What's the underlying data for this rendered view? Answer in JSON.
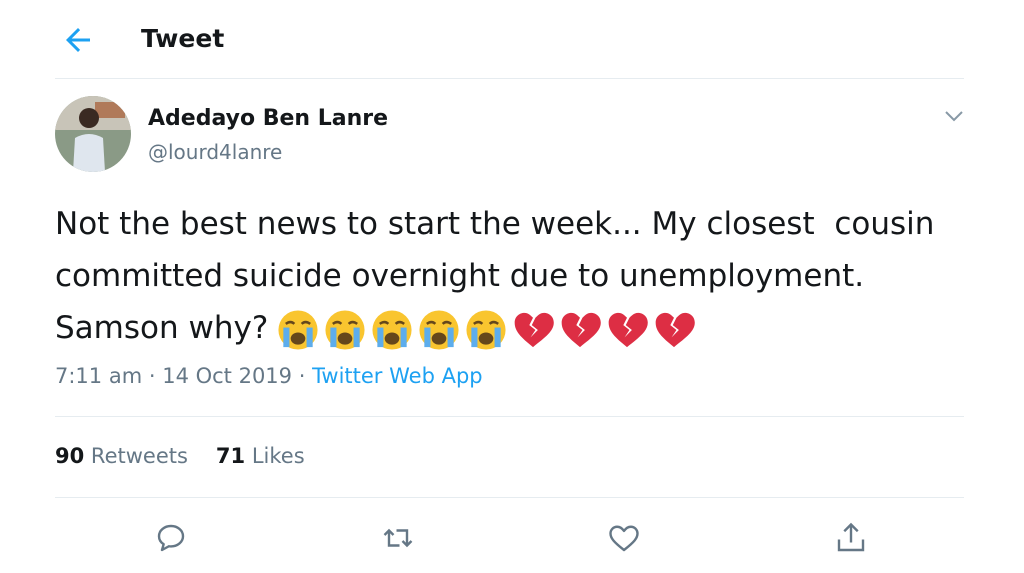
{
  "header": {
    "title": "Tweet",
    "back_icon": "arrow-left-icon"
  },
  "author": {
    "name": "Adedayo Ben Lanre",
    "handle": "@lourd4lanre"
  },
  "tweet": {
    "line1": "Not the best news to start the week... My closest  cousin",
    "line2": "committed suicide overnight due to unemployment.",
    "line3": "Samson why?",
    "emojis": [
      "loudly-crying-face",
      "loudly-crying-face",
      "loudly-crying-face",
      "loudly-crying-face",
      "loudly-crying-face",
      "broken-heart",
      "broken-heart",
      "broken-heart",
      "broken-heart"
    ]
  },
  "meta": {
    "time": "7:11 am",
    "separator": " · ",
    "date": "14 Oct 2019",
    "app": "Twitter Web App"
  },
  "stats": {
    "retweets_count": "90",
    "retweets_label": "Retweets",
    "likes_count": "71",
    "likes_label": "Likes"
  },
  "actions": [
    "reply-icon",
    "retweet-icon",
    "like-icon",
    "share-icon"
  ],
  "colors": {
    "accent": "#1da1f2",
    "secondary_text": "#657786",
    "divider": "#e6ecf0",
    "emoji_face": "#f9c52f",
    "broken_heart": "#dd2e44"
  }
}
